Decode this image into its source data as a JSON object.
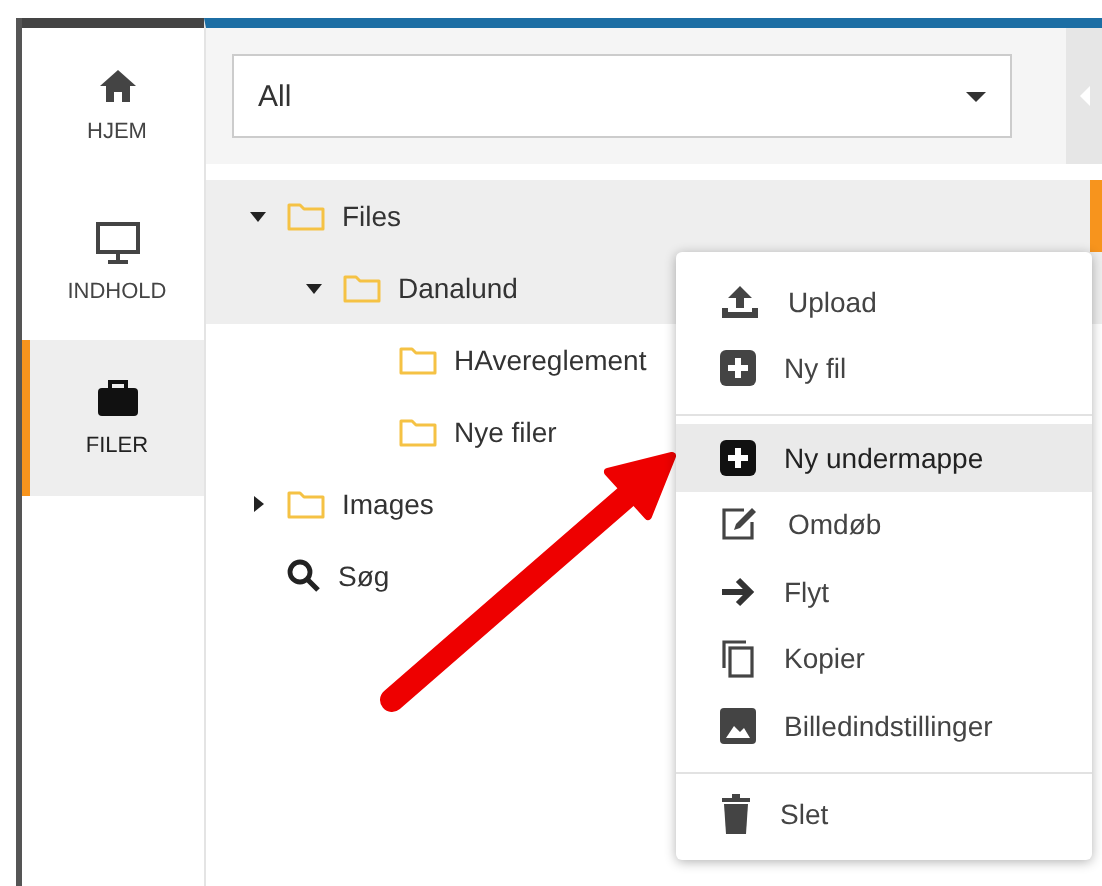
{
  "sidebar": {
    "items": [
      {
        "label": "HJEM",
        "selected": false
      },
      {
        "label": "INDHOLD",
        "selected": false
      },
      {
        "label": "FILER",
        "selected": true
      }
    ]
  },
  "filter": {
    "value": "All"
  },
  "tree": [
    {
      "label": "Files",
      "kind": "branch",
      "expanded": true,
      "selected": true,
      "current": true,
      "children": [
        {
          "label": "Danalund",
          "kind": "branch",
          "expanded": true,
          "selected": true,
          "current": false,
          "children": [
            {
              "label": "HAvereglement",
              "kind": "leaf",
              "selected": false,
              "current": false
            },
            {
              "label": "Nye filer",
              "kind": "leaf",
              "selected": false,
              "current": false
            }
          ]
        }
      ]
    },
    {
      "label": "Images",
      "kind": "branch",
      "expanded": false,
      "selected": false,
      "current": false
    },
    {
      "label": "Søg",
      "kind": "search",
      "selected": false,
      "current": false
    }
  ],
  "context_menu": {
    "groups": [
      [
        {
          "label": "Upload",
          "selected": false
        },
        {
          "label": "Ny fil",
          "selected": false
        }
      ],
      [
        {
          "label": "Ny undermappe",
          "selected": true
        },
        {
          "label": "Omdøb",
          "selected": false
        },
        {
          "label": "Flyt",
          "selected": false
        },
        {
          "label": "Kopier",
          "selected": false
        },
        {
          "label": "Billedindstillinger",
          "selected": false
        }
      ],
      [
        {
          "label": "Slet",
          "selected": false
        }
      ]
    ]
  }
}
